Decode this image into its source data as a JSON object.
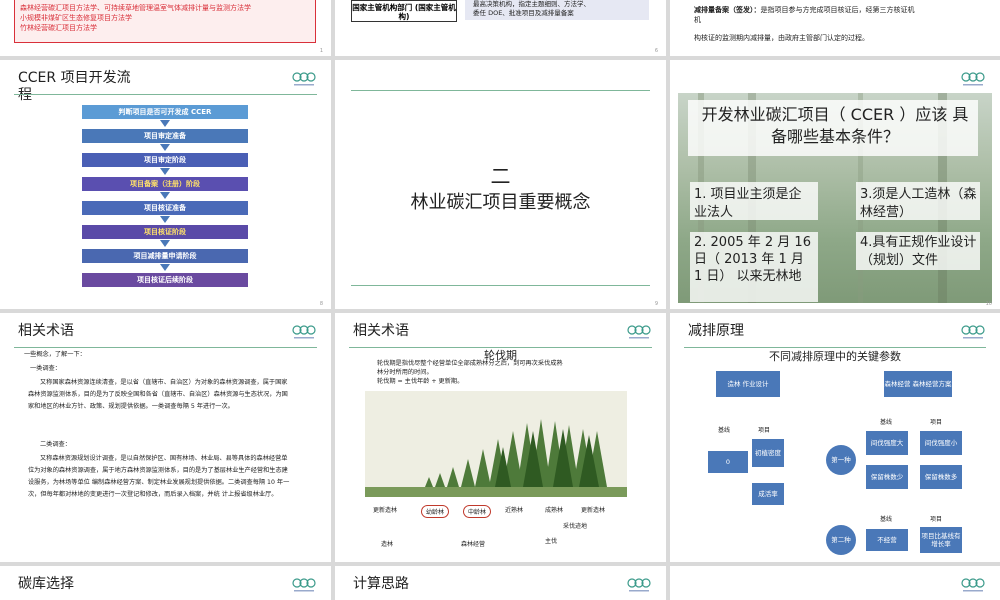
{
  "s1": {
    "lines": [
      "森林经营碳汇项目方法学、可持续草地管理温室气体减排计量与监测方法学",
      "小规模非煤矿区生态修复项目方法学",
      "竹林经营碳汇项目方法学"
    ],
    "page": "1"
  },
  "s2": {
    "box_label": "国家主管机构部门 (国家主管机构)",
    "bullet1": "最高决策机构，指定主题细则、方法学、",
    "bullet2": "委任 DOE、批准项目及减排量备案",
    "page": "6"
  },
  "s3": {
    "term": "减排量备案（签发）：",
    "def1": "是指项目参与方完成项目核证后，经第三方核证机",
    "def2": "构核证的监测期内减排量，由政府主管部门认定的过程。",
    "page": ""
  },
  "s4": {
    "title": "CCER 项目开发流程",
    "steps": [
      "判断项目是否可开发成 CCER",
      "项目审定准备",
      "项目审定阶段",
      "项目备案（注册）阶段",
      "项目核证准备",
      "项目核证阶段",
      "项目减排量申请阶段",
      "项目核证后续阶段"
    ],
    "colors": [
      "#5b9bd5",
      "#4a78b8",
      "#4a5fb5",
      "#5a4fb0",
      "#4a6ab8",
      "#5a4aa8",
      "#4a68b0",
      "#6a4aa0"
    ],
    "page": "8"
  },
  "s5": {
    "num": "二",
    "heading": "林业碳汇项目重要概念",
    "page": "9"
  },
  "s6": {
    "question": "开发林业碳汇项目（ CCER ）应该 具备哪些基本条件？",
    "c1": "1. 项目业主须是企 业法人",
    "c2": "2. 2005 年 2 月 16 日（ 2013 年 1 月 1 日） 以来无林地",
    "c3": "3.须是人工造林（森林经营）",
    "c4": "4.具有正规作业设计（规划）文件",
    "page": "10"
  },
  "s7": {
    "title": "相关术语",
    "intro": "一些概念，了解一下：",
    "t1": "一类调查：",
    "p1": "又称国家森林资源连续清查，是以省（直辖市、自治区）为对象的森林资源调查，属于国家森林资源监测体系，目的是为了反映全国和各省（直辖市、自治区）森林资源与生态状况，为国家和地区的林业方针、政策、规划提供依据。一类调查每隔 5 年进行一次。",
    "t2": "二类调查：",
    "p2": "又称森林资源规划设计调查，是以自然保护区、国有林场、林业局、县等具体的森林经营单位为对象的森林资源调查，属于地方森林资源监测体系，目的是为了基层林业生产经营和生态建设服务，为林场等单位 编制森林经营方案、制定林业发展规划提供依据。二类调查每隔 10 年一 次，但每年都对林地的变更进行一次登记和修改，而后录入档案，并统 计上报省级林业厅。",
    "page": ""
  },
  "s8": {
    "title": "相关术语",
    "sub": "轮伐期",
    "desc1": "轮伐期是指伐尽整个经营单位全部成熟林分之后，到可再次采伐成熟",
    "desc2": "林分时所用的时间。",
    "formula": "轮伐期 = 主伐年龄 + 更新期。",
    "labels": [
      "更新造林",
      "幼龄林",
      "中龄林",
      "近熟林",
      "成熟林",
      "更新造林"
    ],
    "bottom": [
      "造林",
      "森林经营",
      "主伐",
      "采伐迹地"
    ],
    "page": ""
  },
  "s9": {
    "title": "减排原理",
    "sub": "不同减排原理中的关键参数",
    "b_zaolin": "造林 作业设计",
    "b_senlin": "森林经营 森林经营方案",
    "h_baseline": "基线",
    "h_project": "项目",
    "zero": "0",
    "b_init": "初植密度",
    "b_survive": "成活率",
    "circle1": "第一种",
    "b_intensity_lo": "间伐强度大",
    "b_intensity_hi": "间伐强度小",
    "b_keep_lo": "保留株数少",
    "b_keep_hi": "保留株数多",
    "h_baseline2": "基线",
    "h_project2": "项目",
    "circle2": "第二种",
    "b_noop": "不经营",
    "b_ratio": "项目比基线有增长率",
    "page": ""
  },
  "s10": {
    "title": "碳库选择"
  },
  "s11": {
    "title": "计算思路"
  },
  "colors": {
    "rule": "#7fb79a",
    "blue": "#4a78b8",
    "red": "#d9303a"
  }
}
